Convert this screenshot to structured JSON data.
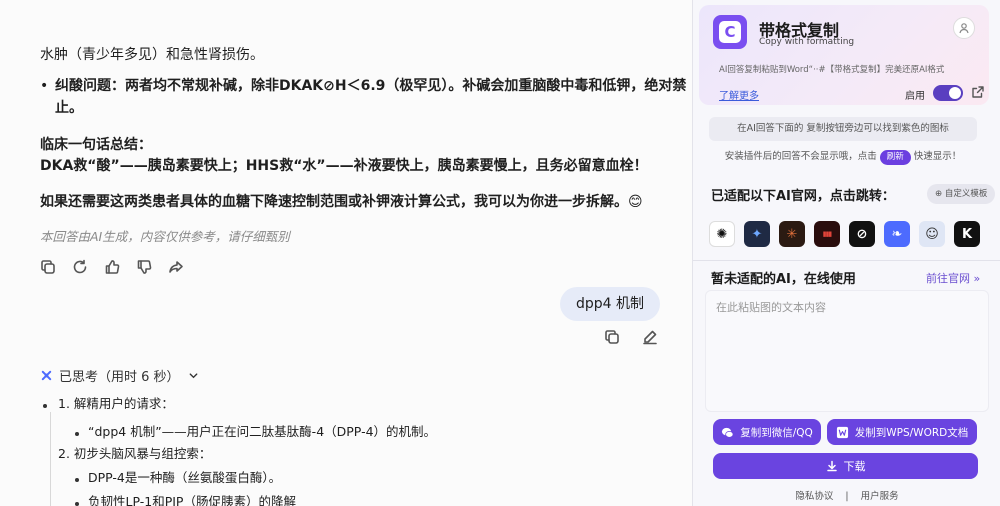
{
  "chat": {
    "line1": "水肿（青少年多见）和急性肾损伤。",
    "bullet1": "纠酸问题：两者均不常规补碱，除非DKAK⊘H＜6.9（极罕见）。补碱会加重脑酸中毒和低钾，绝对禁",
    "bullet1_cont": "止。",
    "summary_title": "临床一句话总结：",
    "summary_body": "DKA救“酸”——胰岛素要快上；HHS救“水”——补液要快上，胰岛素要慢上，且务必留意血栓！",
    "offer": "如果还需要这两类患者具体的血糖下降速控制范围或补钾液计算公式，我可以为你进一步拆解。😊",
    "disclaimer": "本回答由AI生成，内容仅供参考，请仔细甄别",
    "user_message": "dpp4 机制",
    "thinking": "已思考（用时 6 秒）",
    "think_items": {
      "i1": "1. 解精用户的请求：",
      "i1a": "“dpp4 机制”——用户正在问二肽基肽酶-4（DPP-4）的机制。",
      "i2": "2. 初步头脑风暴与组控索：",
      "i2a": "DPP-4是一种酶（丝氨酸蛋白酶）。",
      "i2b": "负韧性LP-1和PIP（肠促胰素）的降解"
    }
  },
  "panel": {
    "title": "带格式复制",
    "subtitle": "Copy with formatting",
    "logo_letter": "C",
    "desc": "AI回答复制粘贴到Word“··#【带格式复制】完美还原AI格式",
    "learn_more": "了解更多",
    "enable_label": "启用",
    "info1": "在AI回答下面的 复制按钮旁边可以找到紫色的图标",
    "info2_before": "安装插件后的回答不会显示哦，点击",
    "info2_pill": "刷新",
    "info2_after": "快速显示！",
    "section1": "已适配以下AI官网，点击跳转：",
    "custom_btn": "⊕ 自定义模板",
    "ai_sites": [
      {
        "name": "ChatGPT",
        "glyph": "✺",
        "bg": "#ffffff",
        "fg": "#111111"
      },
      {
        "name": "Gemini",
        "glyph": "✦",
        "bg": "#1f2a44",
        "fg": "#6ea8ff"
      },
      {
        "name": "Claude",
        "glyph": "✳",
        "bg": "#2b1a12",
        "fg": "#e0703c"
      },
      {
        "name": "Voice",
        "glyph": "▮▮▮",
        "bg": "#2a0d0d",
        "fg": "#e0443a"
      },
      {
        "name": "Perplexity",
        "glyph": "⊘",
        "bg": "#111111",
        "fg": "#ffffff"
      },
      {
        "name": "DeepSeek",
        "glyph": "❧",
        "bg": "#4d6bfe",
        "fg": "#ffffff"
      },
      {
        "name": "Avatar",
        "glyph": "☺",
        "bg": "#dfe6f5",
        "fg": "#333333"
      },
      {
        "name": "Kimi",
        "glyph": "K",
        "bg": "#111111",
        "fg": "#ffffff"
      }
    ],
    "section2": "暂未适配的AI，在线使用",
    "goto_site": "前往官网 »",
    "textarea_placeholder": "在此粘贴图的文本内容",
    "btn_wechat": "复制到微信/QQ",
    "btn_wps": "发制到WPS/WORD文档",
    "btn_download": "下载",
    "footer_left": "隐私协议",
    "footer_sep": "|",
    "footer_right": "用户服务"
  }
}
